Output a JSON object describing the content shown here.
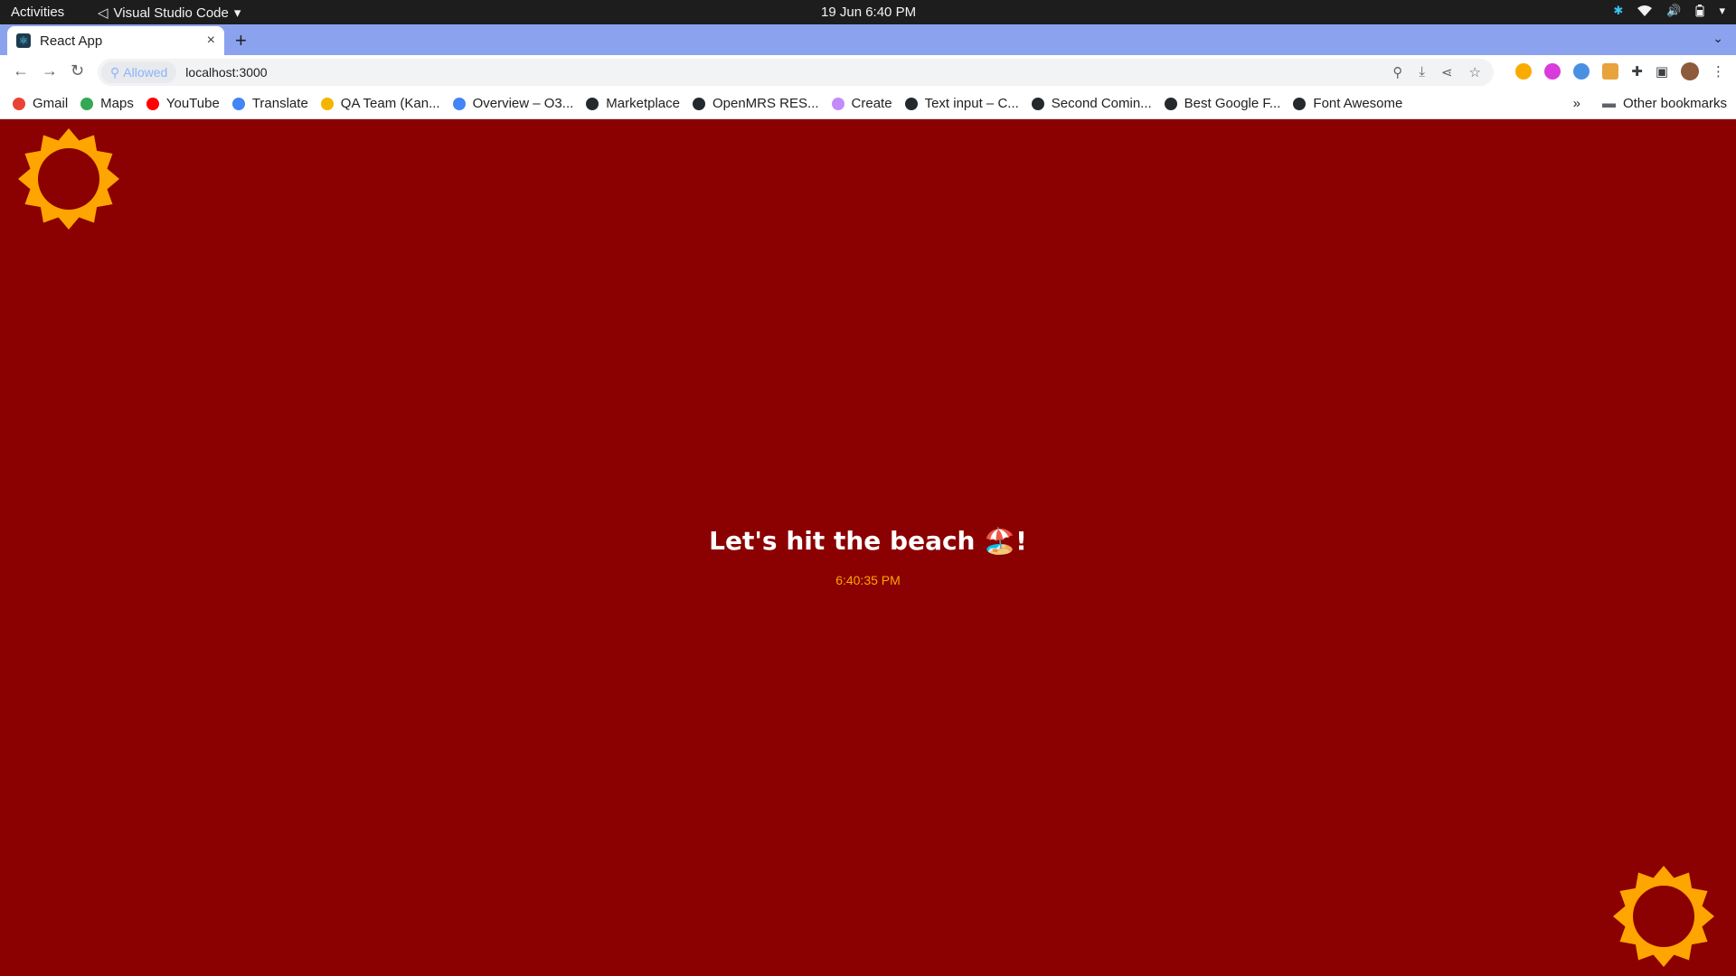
{
  "system": {
    "activities": "Activities",
    "app_name": "Visual Studio Code",
    "clock": "19 Jun  6:40 PM"
  },
  "browser": {
    "tab_title": "React App",
    "new_tab": "+",
    "close": "×",
    "site_permission": "Allowed",
    "url": "localhost:3000",
    "bookmarks": [
      {
        "label": "Gmail",
        "color": "#ea4335"
      },
      {
        "label": "Maps",
        "color": "#34a853"
      },
      {
        "label": "YouTube",
        "color": "#ff0000"
      },
      {
        "label": "Translate",
        "color": "#4285f4"
      },
      {
        "label": "QA Team (Kan...",
        "color": "#f4b400"
      },
      {
        "label": "Overview – O3...",
        "color": "#4285f4"
      },
      {
        "label": "Marketplace",
        "color": "#24292e"
      },
      {
        "label": "OpenMRS RES...",
        "color": "#24292e"
      },
      {
        "label": "Create",
        "color": "#c58af9"
      },
      {
        "label": "Text input – C...",
        "color": "#24292e"
      },
      {
        "label": "Second Comin...",
        "color": "#24292e"
      },
      {
        "label": "Best Google F...",
        "color": "#24292e"
      },
      {
        "label": "Font Awesome",
        "color": "#24292e"
      }
    ],
    "more": "»",
    "other_bookmarks": "Other bookmarks"
  },
  "page": {
    "heading": "Let's hit the beach 🏖️!",
    "time": "6:40:35 PM",
    "background_color": "#8b0000",
    "sun_color": "#ffa500"
  }
}
